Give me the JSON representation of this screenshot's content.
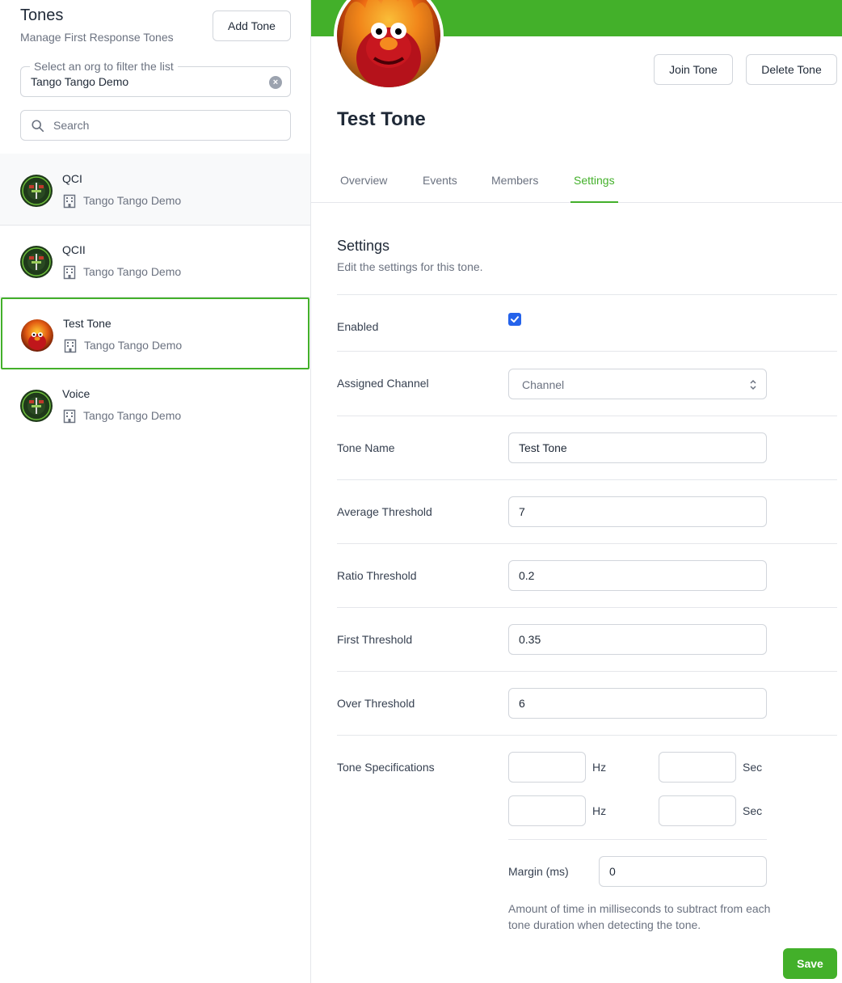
{
  "sidebar": {
    "title": "Tones",
    "subtitle": "Manage First Response Tones",
    "add_button": "Add Tone",
    "org_filter": {
      "legend": "Select an org to filter the list",
      "value": "Tango Tango Demo"
    },
    "search": {
      "placeholder": "Search"
    },
    "items": [
      {
        "name": "QCI",
        "org": "Tango Tango Demo",
        "avatar": "emblem-avatar"
      },
      {
        "name": "QCII",
        "org": "Tango Tango Demo",
        "avatar": "emblem-avatar"
      },
      {
        "name": "Test Tone",
        "org": "Tango Tango Demo",
        "avatar": "flame-avatar"
      },
      {
        "name": "Voice",
        "org": "Tango Tango Demo",
        "avatar": "emblem-avatar"
      }
    ]
  },
  "header": {
    "banner_color": "#43b02a",
    "join_button": "Join Tone",
    "delete_button": "Delete Tone",
    "title": "Test Tone"
  },
  "tabs": [
    {
      "label": "Overview",
      "active": false
    },
    {
      "label": "Events",
      "active": false
    },
    {
      "label": "Members",
      "active": false
    },
    {
      "label": "Settings",
      "active": true
    }
  ],
  "settings": {
    "title": "Settings",
    "subtitle": "Edit the settings for this tone.",
    "enabled_label": "Enabled",
    "enabled": true,
    "channel_label": "Assigned Channel",
    "channel_placeholder": "Channel",
    "tone_name_label": "Tone Name",
    "tone_name": "Test Tone",
    "avg_threshold_label": "Average Threshold",
    "avg_threshold": "7",
    "ratio_threshold_label": "Ratio Threshold",
    "ratio_threshold": "0.2",
    "first_threshold_label": "First Threshold",
    "first_threshold": "0.35",
    "over_threshold_label": "Over Threshold",
    "over_threshold": "6",
    "tone_spec_label": "Tone Specifications",
    "hz_unit": "Hz",
    "sec_unit": "Sec",
    "margin_label": "Margin (ms)",
    "margin_value": "0",
    "margin_help": "Amount of time in milliseconds to subtract from each tone duration when detecting the tone.",
    "save_button": "Save"
  },
  "colors": {
    "accent": "#43b02a",
    "checkbox": "#2563eb"
  }
}
